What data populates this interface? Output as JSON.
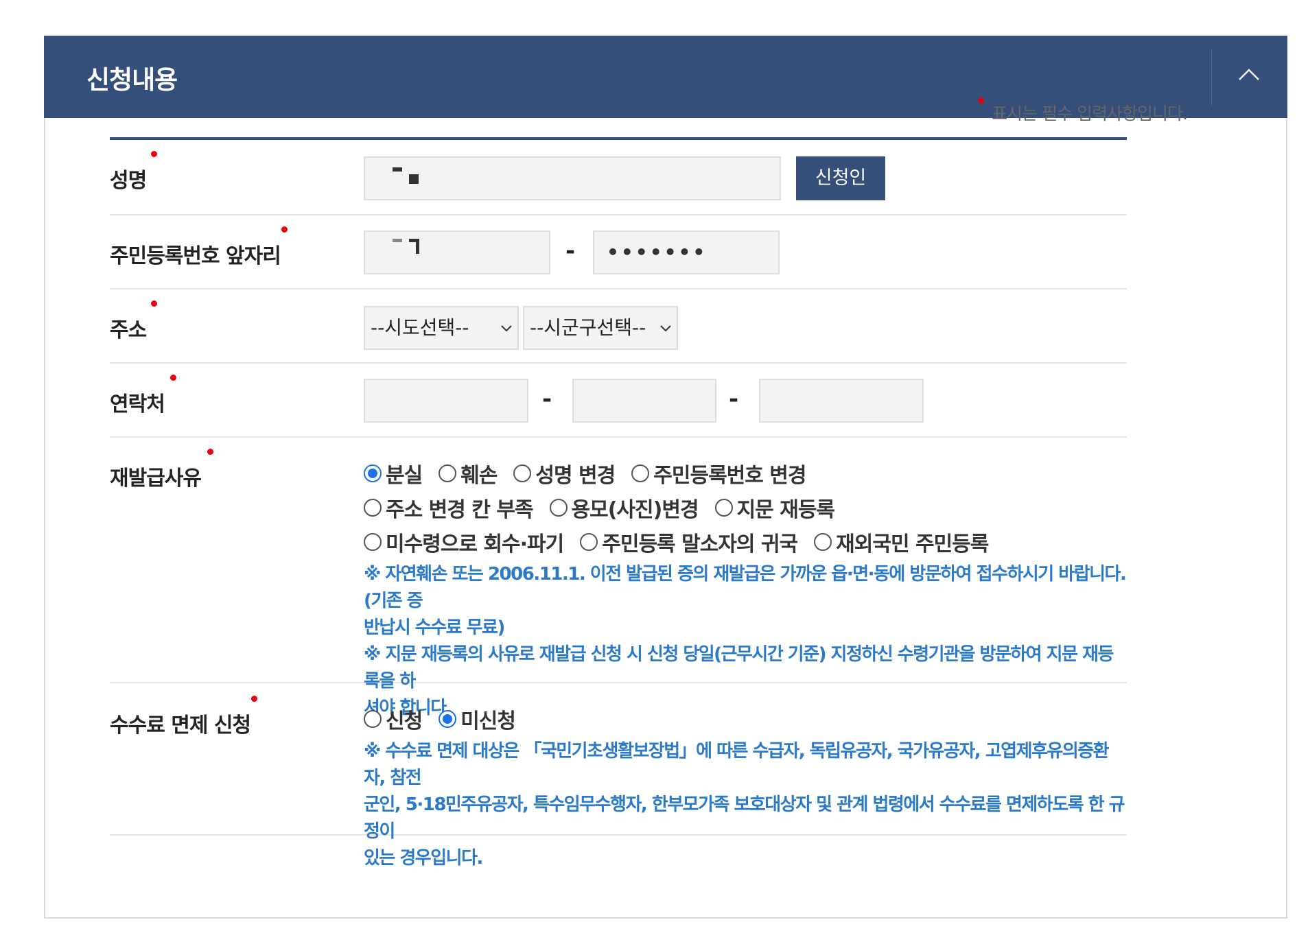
{
  "panel": {
    "title": "신청내용",
    "collapse_icon": "chevron-up-icon"
  },
  "required_note": "표시는 필수 입력사항입니다.",
  "fields": {
    "name": {
      "label": "성명",
      "button": "신청인"
    },
    "rrn": {
      "label": "주민등록번호 앞자리",
      "back_value": "•••••••",
      "dash": "-"
    },
    "address": {
      "label": "주소",
      "sido": "--시도선택--",
      "sigungu": "--시군구선택--"
    },
    "contact": {
      "label": "연락처",
      "dash": "-"
    },
    "reason": {
      "label": "재발급사유",
      "options": [
        {
          "label": "분실",
          "selected": true
        },
        {
          "label": "훼손",
          "selected": false
        },
        {
          "label": "성명 변경",
          "selected": false
        },
        {
          "label": "주민등록번호 변경",
          "selected": false
        },
        {
          "label": "주소 변경 칸 부족",
          "selected": false
        },
        {
          "label": "용모(사진)변경",
          "selected": false
        },
        {
          "label": "지문 재등록",
          "selected": false
        },
        {
          "label": "미수령으로 회수·파기",
          "selected": false
        },
        {
          "label": "주민등록 말소자의 귀국",
          "selected": false
        },
        {
          "label": "재외국민 주민등록",
          "selected": false
        }
      ],
      "note1_line1": "※ 자연훼손 또는 2006.11.1. 이전 발급된 증의 재발급은 가까운 읍·면·동에 방문하여 접수하시기 바랍니다.(기존 증",
      "note1_line2": "반납시 수수료 무료)",
      "note2_line1": "※ 지문 재등록의 사유로 재발급 신청 시 신청 당일(근무시간 기준) 지정하신 수령기관을 방문하여 지문 재등록을 하",
      "note2_line2": "셔야 합니다."
    },
    "fee": {
      "label": "수수료 면제 신청",
      "options": [
        {
          "label": "신청",
          "selected": false
        },
        {
          "label": "미신청",
          "selected": true
        }
      ],
      "note_line1": "※ 수수료 면제 대상은 「국민기초생활보장법」에 따른 수급자, 독립유공자, 국가유공자, 고엽제후유의증환자, 참전",
      "note_line2": "군인, 5·18민주유공자, 특수임무수행자, 한부모가족 보호대상자 및 관계 법령에서 수수료를 면제하도록 한 규정이",
      "note_line3": "있는 경우입니다."
    }
  }
}
